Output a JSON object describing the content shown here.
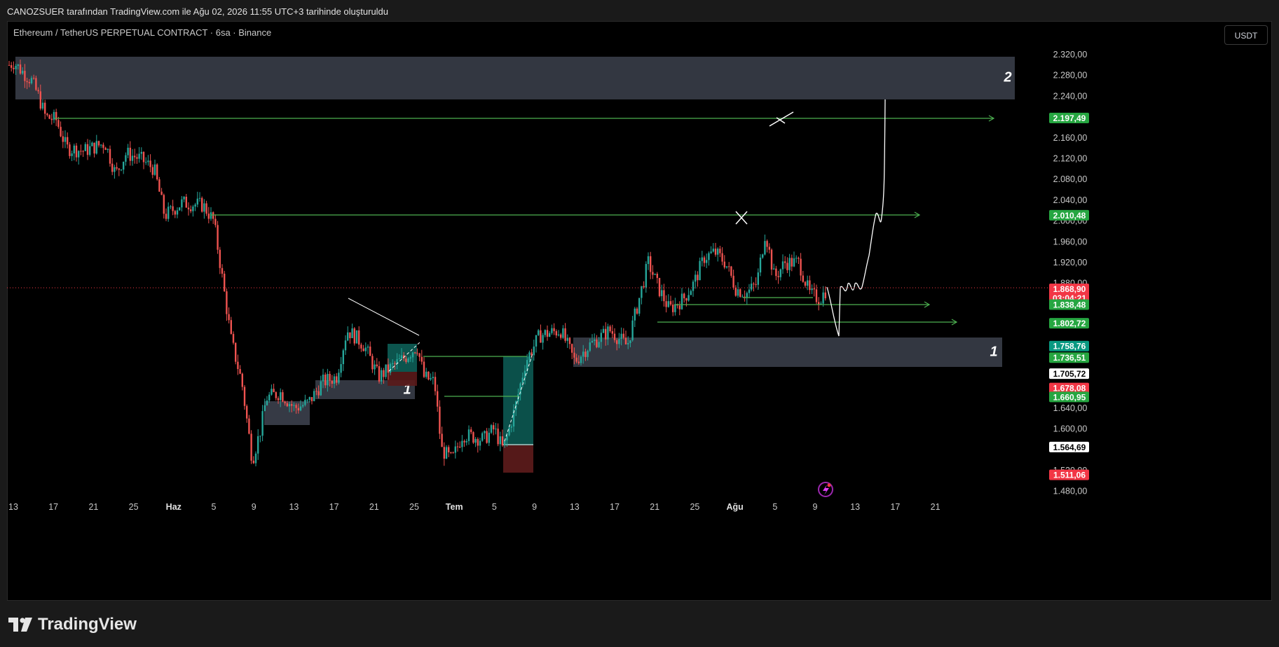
{
  "header": {
    "attribution": "CANOZSUER tarafından TradingView.com ile Ağu 02, 2026 11:55 UTC+3 tarihinde oluşturuldu"
  },
  "chart": {
    "symbol_title": "Ethereum / TetherUS PERPETUAL CONTRACT · 6sa · Binance",
    "currency": "USDT",
    "price_axis": [
      "2.320,00",
      "2.280,00",
      "2.240,00",
      "2.160,00",
      "2.120,00",
      "2.080,00",
      "2.040,00",
      "2.000,00",
      "1.960,00",
      "1.920,00",
      "1.880,00",
      "1.640,00",
      "1.600,00",
      "1.520,00",
      "1.480,00"
    ],
    "date_axis": [
      {
        "label": "13",
        "major": false
      },
      {
        "label": "17",
        "major": false
      },
      {
        "label": "21",
        "major": false
      },
      {
        "label": "25",
        "major": false
      },
      {
        "label": "Haz",
        "major": true
      },
      {
        "label": "5",
        "major": false
      },
      {
        "label": "9",
        "major": false
      },
      {
        "label": "13",
        "major": false
      },
      {
        "label": "17",
        "major": false
      },
      {
        "label": "21",
        "major": false
      },
      {
        "label": "25",
        "major": false
      },
      {
        "label": "Tem",
        "major": true
      },
      {
        "label": "5",
        "major": false
      },
      {
        "label": "9",
        "major": false
      },
      {
        "label": "13",
        "major": false
      },
      {
        "label": "17",
        "major": false
      },
      {
        "label": "21",
        "major": false
      },
      {
        "label": "25",
        "major": false
      },
      {
        "label": "Ağu",
        "major": true
      },
      {
        "label": "5",
        "major": false
      },
      {
        "label": "9",
        "major": false
      },
      {
        "label": "13",
        "major": false
      },
      {
        "label": "17",
        "major": false
      },
      {
        "label": "21",
        "major": false
      }
    ],
    "price_labels": [
      {
        "price": "2.197,49",
        "bg": "#26a641",
        "fg": "#ffffff"
      },
      {
        "price": "2.010,48",
        "bg": "#26a641",
        "fg": "#ffffff"
      },
      {
        "price": "1.868,90",
        "countdown": "03:04:21",
        "bg": "#f23645",
        "fg": "#ffffff"
      },
      {
        "price": "1.838,48",
        "bg": "#26a641",
        "fg": "#ffffff"
      },
      {
        "price": "1.802,72",
        "bg": "#26a641",
        "fg": "#ffffff"
      },
      {
        "price": "1.758,76",
        "bg": "#089981",
        "fg": "#ffffff"
      },
      {
        "price": "1.736,51",
        "bg": "#26a641",
        "fg": "#ffffff"
      },
      {
        "price": "1.705,72",
        "bg": "#ffffff",
        "fg": "#000000"
      },
      {
        "price": "1.678,08",
        "bg": "#f23645",
        "fg": "#ffffff"
      },
      {
        "price": "1.660,95",
        "bg": "#26a641",
        "fg": "#ffffff"
      },
      {
        "price": "1.564,69",
        "bg": "#ffffff",
        "fg": "#000000"
      },
      {
        "price": "1.511,06",
        "bg": "#f23645",
        "fg": "#ffffff"
      }
    ],
    "zones": [
      {
        "label": "2"
      },
      {
        "label": "1"
      },
      {
        "label": "1"
      }
    ],
    "colors": {
      "up": "#26a69a",
      "down": "#ef5350",
      "line": "#4caf50",
      "zone": "#363a45"
    }
  },
  "footer": {
    "brand": "TradingView",
    "logo_icon": "tradingview-logo-icon"
  }
}
